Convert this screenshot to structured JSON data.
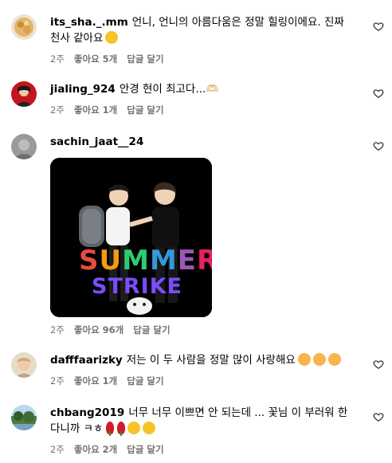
{
  "comments": [
    {
      "username": "its_sha._.mm",
      "text": "언니, 언니의 아름다움은 정말 힐링이에요. 진짜 천사 같아요",
      "emoji": [
        "smiling-face"
      ],
      "age": "2주",
      "likes": "좋아요 5개",
      "reply": "답글 달기"
    },
    {
      "username": "jialing_924",
      "text": "안경 현이 최고다...🫶🏻",
      "emoji": [],
      "age": "2주",
      "likes": "좋아요 1개",
      "reply": "답글 달기"
    },
    {
      "username": "sachin_jaat__24",
      "text": "",
      "emoji": [],
      "attachment": {
        "kind": "sticker",
        "line1": "SUMMER",
        "line2": "STRIKE",
        "colors": [
          "#e84c3d",
          "#f39c12",
          "#2ecc71",
          "#3498db",
          "#9b59b6",
          "#e91e63"
        ]
      },
      "age": "2주",
      "likes": "좋아요 96개",
      "reply": "답글 달기"
    },
    {
      "username": "dafffaarizky",
      "text": "저는 이 두 사람을 정말 많이 사랑해요",
      "emoji": [
        "smiling-face-with-hearts",
        "smiling-face-with-hearts",
        "smiling-face-with-hearts"
      ],
      "age": "2주",
      "likes": "좋아요 1개",
      "reply": "답글 달기"
    },
    {
      "username": "chbang2019",
      "text": "너무 너무 이쁘면 안 되는데 ... 꽃님 이 부러워 한 다니까 ㅋㅎ",
      "emoji": [
        "rose",
        "rose",
        "laughing-face",
        "laughing-face"
      ],
      "age": "2주",
      "likes": "좋아요 2개",
      "reply": "답글 달기"
    }
  ],
  "colors": {
    "meta": "#737373",
    "text": "#000000",
    "heart_outline": "#262626"
  }
}
